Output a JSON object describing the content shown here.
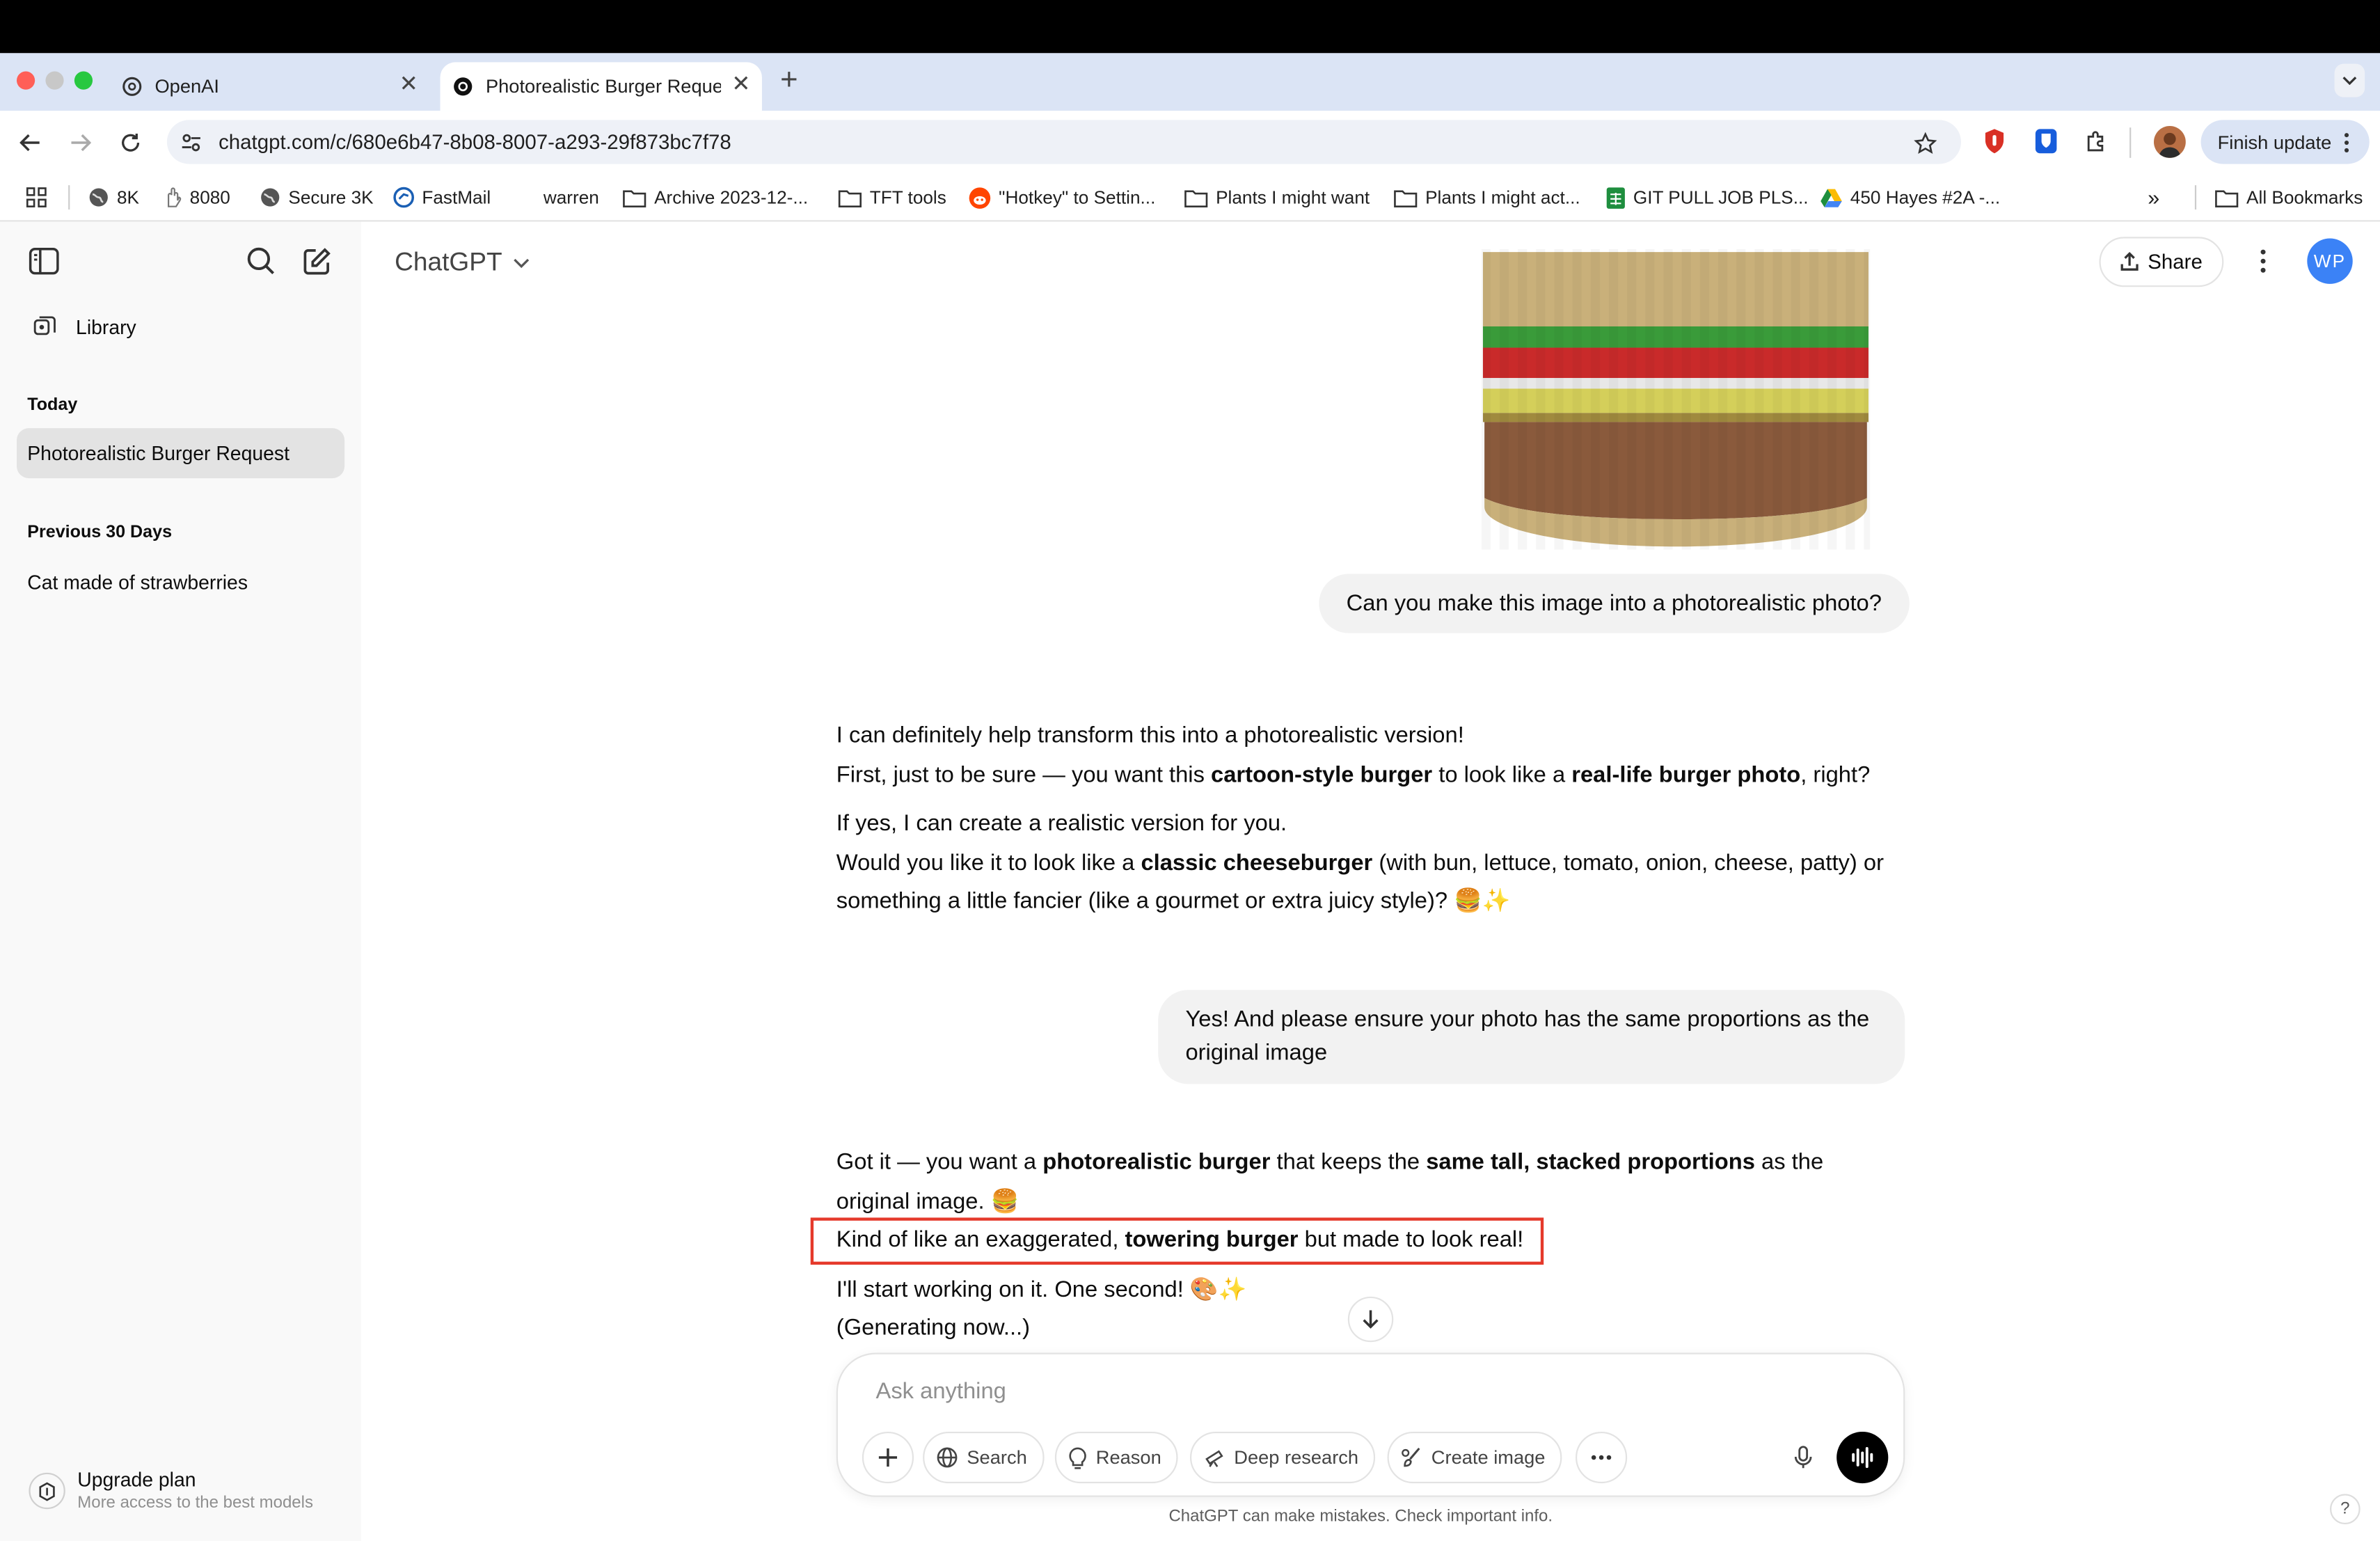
{
  "browser": {
    "tabs": [
      {
        "title": "OpenAI",
        "active": false
      },
      {
        "title": "Photorealistic Burger Request",
        "active": true
      }
    ],
    "new_tab": "+",
    "url": "chatgpt.com/c/680e6b47-8b08-8007-a293-29f873bc7f78",
    "finish_update": "Finish update",
    "bookmarks": [
      {
        "label": "8K",
        "icon": "globe-icon"
      },
      {
        "label": "8080",
        "icon": "hand-icon"
      },
      {
        "label": "Secure 3K",
        "icon": "globe-icon"
      },
      {
        "label": "FastMail",
        "icon": "fastmail-icon"
      },
      {
        "label": "warren",
        "icon": "none"
      },
      {
        "label": "Archive 2023-12-...",
        "icon": "folder-icon"
      },
      {
        "label": "TFT tools",
        "icon": "folder-icon"
      },
      {
        "label": "\"Hotkey\" to Settin...",
        "icon": "reddit-icon"
      },
      {
        "label": "Plants I might want",
        "icon": "folder-icon"
      },
      {
        "label": "Plants I might act...",
        "icon": "folder-icon"
      },
      {
        "label": "GIT PULL JOB PLS...",
        "icon": "sheets-icon"
      },
      {
        "label": "450 Hayes #2A -...",
        "icon": "drive-icon"
      }
    ],
    "more_bookmarks": "»",
    "all_bookmarks": "All Bookmarks"
  },
  "sidebar": {
    "library": "Library",
    "today_heading": "Today",
    "today_items": [
      "Photorealistic Burger Request"
    ],
    "prev_heading": "Previous 30 Days",
    "prev_items": [
      "Cat made of strawberries"
    ],
    "upgrade_title": "Upgrade plan",
    "upgrade_sub": "More access to the best models"
  },
  "header": {
    "model": "ChatGPT",
    "share": "Share",
    "avatar": "WP"
  },
  "conversation": {
    "user_1": "Can you make this image into a photorealistic photo?",
    "assistant_1": {
      "line1": "I can definitely help transform this into a photorealistic version!",
      "line2_a": "First, just to be sure — you want this ",
      "line2_b": "cartoon-style burger",
      "line2_c": " to look like a ",
      "line2_d": "real-life burger photo",
      "line2_e": ", right?",
      "line3": "If yes, I can create a realistic version for you.",
      "line4_a": "Would you like it to look like a ",
      "line4_b": "classic cheeseburger",
      "line4_c": " (with bun, lettuce, tomato, onion, cheese, patty) or something a little fancier (like a gourmet or extra juicy style)? 🍔✨"
    },
    "user_2": "Yes! And please ensure your photo has the same proportions as the original image",
    "assistant_2": {
      "p1_a": "Got it — you want a ",
      "p1_b": "photorealistic burger",
      "p1_c": " that keeps the ",
      "p1_d": "same tall, stacked proportions",
      "p1_e": " as the original image. 🍔",
      "p2_a": "Kind of like an exaggerated, ",
      "p2_b": "towering burger",
      "p2_c": " but made to look real!",
      "p3": "I'll start working on it. One second! 🎨✨",
      "p4": "(Generating now...)"
    }
  },
  "composer": {
    "placeholder": "Ask anything",
    "buttons": [
      "Search",
      "Reason",
      "Deep research",
      "Create image"
    ],
    "disclaimer": "ChatGPT can make mistakes. Check important info.",
    "help": "?"
  },
  "colors": {
    "highlight_box": "#e5392b",
    "bun": "#c9b07a",
    "lettuce": "#3a9b3a",
    "tomato": "#c92a2a",
    "cheese": "#d4cf5a",
    "patty": "#8a5a3c",
    "avatar_bg": "#3b82f6"
  }
}
